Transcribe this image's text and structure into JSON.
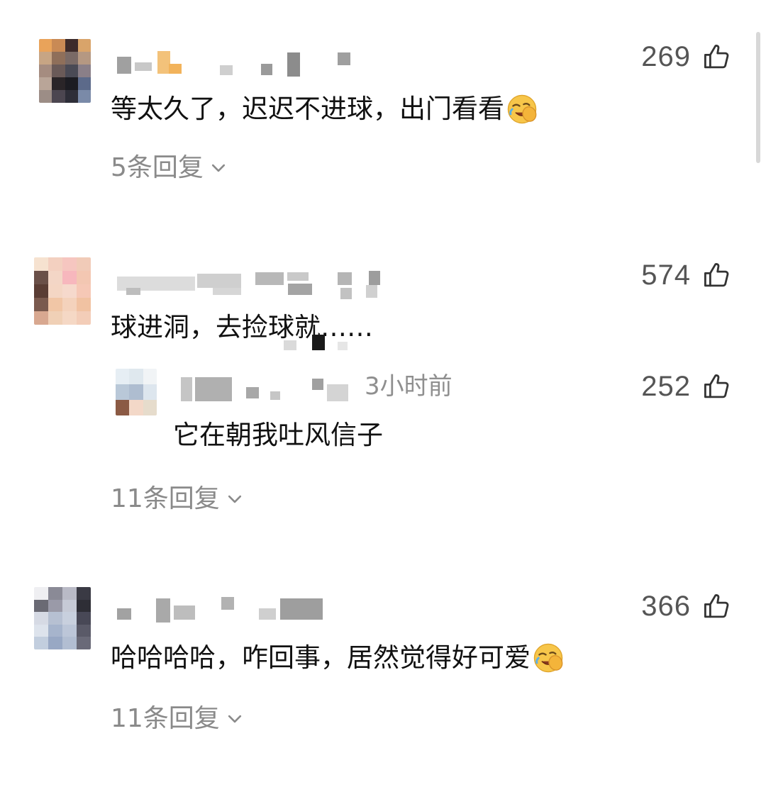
{
  "comments": [
    {
      "likes": "269",
      "text": "等太久了，迟迟不进球，出门看看",
      "emoji": "face-palm-laughing-emoji",
      "replies": "5条回复"
    },
    {
      "likes": "574",
      "text": "球进洞，去捡球就……",
      "reply": {
        "time": "3小时前",
        "likes": "252",
        "text": "它在朝我吐风信子"
      },
      "replies": "11条回复"
    },
    {
      "likes": "366",
      "text": "哈哈哈哈，咋回事，居然觉得好可爱",
      "emoji": "face-palm-laughing-emoji",
      "replies": "11条回复"
    }
  ],
  "icons": {
    "like": "thumbs-up-outline-icon",
    "expand": "chevron-down-icon"
  },
  "colors": {
    "text": "#111111",
    "muted": "#8a8a8a",
    "count": "#555555"
  }
}
